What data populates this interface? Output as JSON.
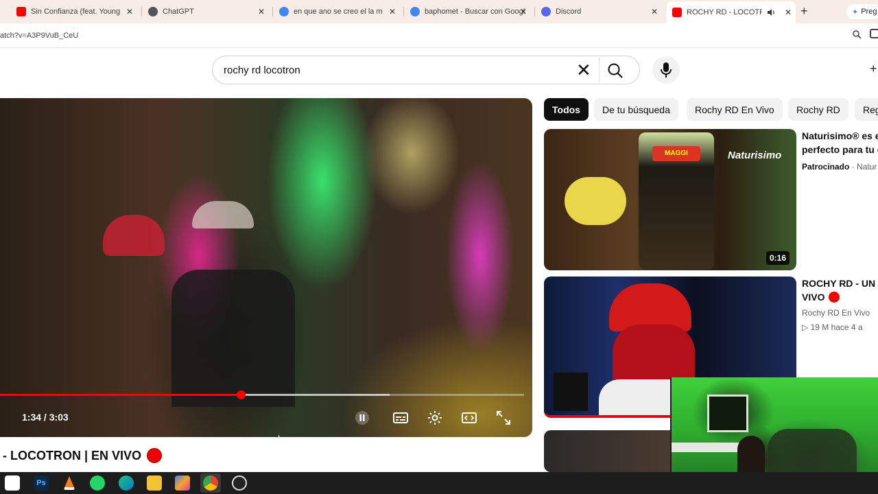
{
  "browser": {
    "tabs": [
      {
        "title": "Sin Confianza (feat. Young Sa",
        "favicon_color": "#ff0000",
        "active": false
      },
      {
        "title": "ChatGPT",
        "favicon_color": "#555555",
        "active": false
      },
      {
        "title": "en que ano se creo el la mone",
        "favicon_color": "#4285f4",
        "active": false
      },
      {
        "title": "baphomet - Buscar con Googl",
        "favicon_color": "#4285f4",
        "active": false
      },
      {
        "title": "Discord",
        "favicon_color": "#5865f2",
        "active": false
      },
      {
        "title": "ROCHY RD - LOCOTRON",
        "favicon_color": "#ff0000",
        "active": true
      }
    ],
    "close_symbol": "✕",
    "new_tab_symbol": "+",
    "extension_label": "Preg",
    "url": "atch?v=A3P9VuB_CeU"
  },
  "youtube": {
    "search_query": "rochy rd locotron",
    "player": {
      "current_time": "1:34",
      "duration": "3:03",
      "time_display": "1:34 / 3:03",
      "progress_fraction": 0.46,
      "title": "- LOCOTRON | EN VIVO"
    },
    "chips": [
      "Todos",
      "De tu búsqueda",
      "Rochy RD En Vivo",
      "Rochy RD",
      "Reg"
    ],
    "recommendations": [
      {
        "title_line1": "Naturisimo® es e",
        "title_line2": "perfecto para tu c",
        "meta1": "Patrocinado",
        "meta1_suffix": "· Natur",
        "duration": "0:16",
        "brand_text": "Naturisimo",
        "logo_text": "MAGGI"
      },
      {
        "title_line1": "ROCHY RD - UN J",
        "title_line2": "VIVO",
        "meta1": "Rochy RD En Vivo",
        "meta2": "▷ 19 M   hace 4 a"
      }
    ]
  },
  "taskbar": {
    "apps": [
      "start-icon",
      "photoshop-icon",
      "vlc-icon",
      "whatsapp-icon",
      "edge-icon",
      "files-icon",
      "copilot-icon",
      "chrome-icon",
      "obs-icon"
    ],
    "ps_label": "Ps"
  }
}
